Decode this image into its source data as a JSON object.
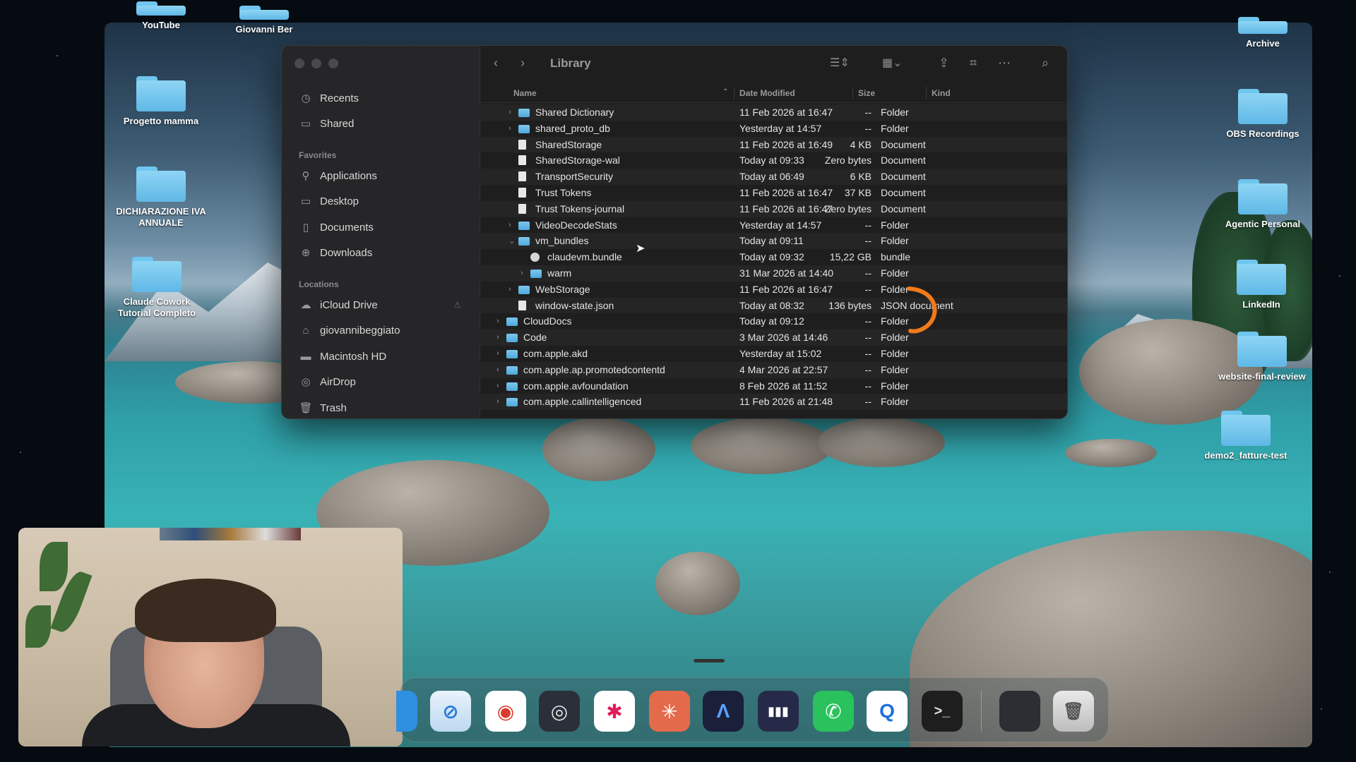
{
  "desktop": {
    "icons_left": [
      {
        "label": "YouTube"
      },
      {
        "label": "Giovanni Ber"
      },
      {
        "label": "Progetto mamma"
      },
      {
        "label": "DICHIARAZIONE IVA ANNUALE"
      },
      {
        "label": "Claude Cowork Tutorial Completo"
      }
    ],
    "icons_right": [
      {
        "label": "Archive"
      },
      {
        "label": "OBS Recordings"
      },
      {
        "label": "Agentic Personal"
      },
      {
        "label": "LinkedIn"
      },
      {
        "label": "website-final-review"
      },
      {
        "label": "demo2_fatture-test"
      }
    ]
  },
  "finder": {
    "title": "Library",
    "sidebar": {
      "top_items": [
        {
          "label": "Recents",
          "icon": "clock-icon"
        },
        {
          "label": "Shared",
          "icon": "shared-folder-icon"
        }
      ],
      "favorites_title": "Favorites",
      "favorites": [
        {
          "label": "Applications",
          "icon": "applications-icon"
        },
        {
          "label": "Desktop",
          "icon": "desktop-icon"
        },
        {
          "label": "Documents",
          "icon": "document-icon"
        },
        {
          "label": "Downloads",
          "icon": "download-icon"
        }
      ],
      "locations_title": "Locations",
      "locations": [
        {
          "label": "iCloud Drive",
          "icon": "cloud-icon"
        },
        {
          "label": "giovannibeggiato",
          "icon": "home-icon"
        },
        {
          "label": "Macintosh HD",
          "icon": "disk-icon"
        },
        {
          "label": "AirDrop",
          "icon": "airdrop-icon"
        },
        {
          "label": "Trash",
          "icon": "trash-icon"
        }
      ]
    },
    "columns": {
      "name": "Name",
      "date": "Date Modified",
      "size": "Size",
      "kind": "Kind"
    },
    "rows": [
      {
        "name": "Shared Dictionary",
        "date": "11 Feb 2026 at 16:47",
        "size": "--",
        "kind": "Folder",
        "type": "folder",
        "indent": 1,
        "chevron": "›"
      },
      {
        "name": "shared_proto_db",
        "date": "Yesterday at 14:57",
        "size": "--",
        "kind": "Folder",
        "type": "folder",
        "indent": 1,
        "chevron": "›"
      },
      {
        "name": "SharedStorage",
        "date": "11 Feb 2026 at 16:49",
        "size": "4 KB",
        "kind": "Document",
        "type": "doc",
        "indent": 1,
        "chevron": ""
      },
      {
        "name": "SharedStorage-wal",
        "date": "Today at 09:33",
        "size": "Zero bytes",
        "kind": "Document",
        "type": "doc",
        "indent": 1,
        "chevron": ""
      },
      {
        "name": "TransportSecurity",
        "date": "Today at 06:49",
        "size": "6 KB",
        "kind": "Document",
        "type": "doc",
        "indent": 1,
        "chevron": ""
      },
      {
        "name": "Trust Tokens",
        "date": "11 Feb 2026 at 16:47",
        "size": "37 KB",
        "kind": "Document",
        "type": "doc",
        "indent": 1,
        "chevron": ""
      },
      {
        "name": "Trust Tokens-journal",
        "date": "11 Feb 2026 at 16:47",
        "size": "Zero bytes",
        "kind": "Document",
        "type": "doc",
        "indent": 1,
        "chevron": ""
      },
      {
        "name": "VideoDecodeStats",
        "date": "Yesterday at 14:57",
        "size": "--",
        "kind": "Folder",
        "type": "folder",
        "indent": 1,
        "chevron": "›"
      },
      {
        "name": "vm_bundles",
        "date": "Today at 09:11",
        "size": "--",
        "kind": "Folder",
        "type": "folder",
        "indent": 1,
        "chevron": "⌄"
      },
      {
        "name": "claudevm.bundle",
        "date": "Today at 09:32",
        "size": "15,22 GB",
        "kind": "bundle",
        "type": "bundle",
        "indent": 2,
        "chevron": ""
      },
      {
        "name": "warm",
        "date": "31 Mar 2026 at 14:40",
        "size": "--",
        "kind": "Folder",
        "type": "folder",
        "indent": 2,
        "chevron": "›"
      },
      {
        "name": "WebStorage",
        "date": "11 Feb 2026 at 16:47",
        "size": "--",
        "kind": "Folder",
        "type": "folder",
        "indent": 1,
        "chevron": "›"
      },
      {
        "name": "window-state.json",
        "date": "Today at 08:32",
        "size": "136 bytes",
        "kind": "JSON document",
        "type": "doc",
        "indent": 1,
        "chevron": ""
      },
      {
        "name": "CloudDocs",
        "date": "Today at 09:12",
        "size": "--",
        "kind": "Folder",
        "type": "folder",
        "indent": 0,
        "chevron": "›"
      },
      {
        "name": "Code",
        "date": "3 Mar 2026 at 14:46",
        "size": "--",
        "kind": "Folder",
        "type": "folder",
        "indent": 0,
        "chevron": "›"
      },
      {
        "name": "com.apple.akd",
        "date": "Yesterday at 15:02",
        "size": "--",
        "kind": "Folder",
        "type": "folder",
        "indent": 0,
        "chevron": "›"
      },
      {
        "name": "com.apple.ap.promotedcontentd",
        "date": "4 Mar 2026 at 22:57",
        "size": "--",
        "kind": "Folder",
        "type": "folder",
        "indent": 0,
        "chevron": "›"
      },
      {
        "name": "com.apple.avfoundation",
        "date": "8 Feb 2026 at 11:52",
        "size": "--",
        "kind": "Folder",
        "type": "folder",
        "indent": 0,
        "chevron": "›"
      },
      {
        "name": "com.apple.callintelligenced",
        "date": "11 Feb 2026 at 21:48",
        "size": "--",
        "kind": "Folder",
        "type": "folder",
        "indent": 0,
        "chevron": "›"
      }
    ]
  },
  "dock": {
    "apps": [
      {
        "name": "finder",
        "glyph": ""
      },
      {
        "name": "safari",
        "glyph": "⊘"
      },
      {
        "name": "chrome",
        "glyph": "◉"
      },
      {
        "name": "obs",
        "glyph": "◎"
      },
      {
        "name": "slack",
        "glyph": "✱"
      },
      {
        "name": "claude",
        "glyph": "✳"
      },
      {
        "name": "affinity",
        "glyph": "Λ"
      },
      {
        "name": "audio-app",
        "glyph": "▮▮▮"
      },
      {
        "name": "whatsapp",
        "glyph": "✆"
      },
      {
        "name": "quicktime",
        "glyph": "Q"
      },
      {
        "name": "terminal",
        "glyph": ">_"
      }
    ]
  },
  "colors": {
    "accent_orange": "#f07a1a",
    "folder_blue": "#5fb8e6"
  }
}
